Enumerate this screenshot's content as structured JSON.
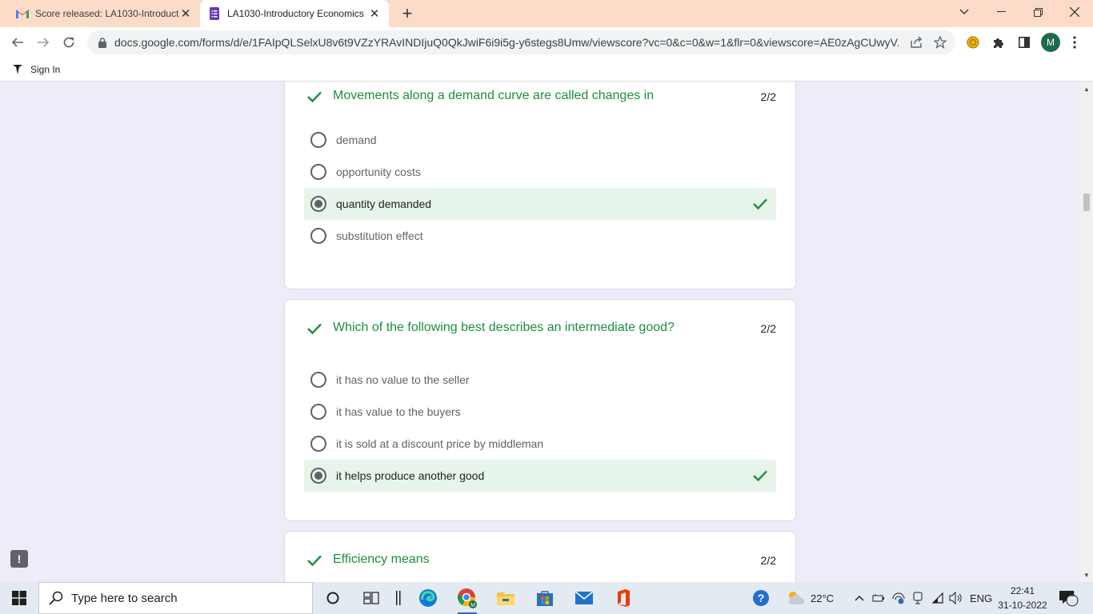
{
  "browser": {
    "tabs": [
      {
        "title": "Score released: LA1030-Introduct",
        "icon": "gmail-icon"
      },
      {
        "title": "LA1030-Introductory Economics",
        "icon": "google-forms-icon"
      }
    ],
    "url": "docs.google.com/forms/d/e/1FAIpQLSelxU8v6t9VZzYRAvINDIjuQ0QkJwiF6i9i5g-y6stegs8Umw/viewscore?vc=0&c=0&w=1&flr=0&viewscore=AE0zAgCUwyV...",
    "profile_initial": "M",
    "bookmark": "Sign In"
  },
  "questions": [
    {
      "title": "Movements along a demand curve are called changes in",
      "points": "2/2",
      "options": [
        {
          "label": "demand",
          "selected": false,
          "correct": false
        },
        {
          "label": "opportunity costs",
          "selected": false,
          "correct": false
        },
        {
          "label": "quantity demanded",
          "selected": true,
          "correct": true
        },
        {
          "label": "substitution effect",
          "selected": false,
          "correct": false
        }
      ]
    },
    {
      "title": "Which of the following best describes an intermediate good?",
      "points": "2/2",
      "options": [
        {
          "label": "it has no value to the seller",
          "selected": false,
          "correct": false
        },
        {
          "label": "it has value to the buyers",
          "selected": false,
          "correct": false
        },
        {
          "label": "it is sold at a discount price by middleman",
          "selected": false,
          "correct": false
        },
        {
          "label": "it helps produce another good",
          "selected": true,
          "correct": true
        }
      ]
    },
    {
      "title": "Efficiency means",
      "points": "2/2"
    }
  ],
  "taskbar": {
    "search_placeholder": "Type here to search",
    "temperature": "22°C",
    "language": "ENG",
    "time": "22:41",
    "date": "31-10-2022",
    "notification_count": "12"
  },
  "colors": {
    "accent_green": "#1e8e3e",
    "correct_bg": "#e6f4ea",
    "page_bg": "#f0ebf8",
    "tab_bar": "#fcdcc9"
  }
}
